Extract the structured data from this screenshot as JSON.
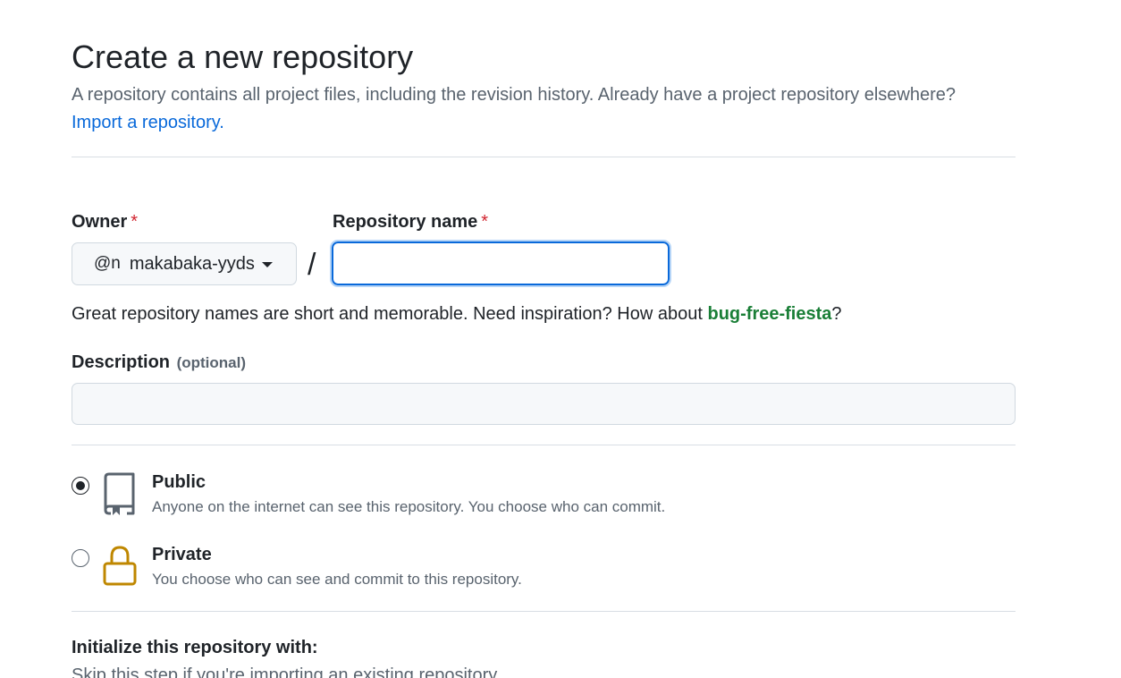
{
  "header": {
    "title": "Create a new repository",
    "subtitle": "A repository contains all project files, including the revision history. Already have a project repository elsewhere?",
    "import_link": "Import a repository."
  },
  "owner": {
    "label": "Owner",
    "required_mark": "*",
    "avatar_text": "@n",
    "selected": "makabaka-yyds"
  },
  "separator": "/",
  "repo_name": {
    "label": "Repository name",
    "required_mark": "*",
    "value": ""
  },
  "name_hint": {
    "text": "Great repository names are short and memorable. Need inspiration? How about ",
    "suggestion": "bug-free-fiesta",
    "suffix": "?"
  },
  "description": {
    "label": "Description",
    "optional": "(optional)",
    "value": ""
  },
  "visibility": {
    "options": [
      {
        "title": "Public",
        "description": "Anyone on the internet can see this repository. You choose who can commit.",
        "icon": "repo-icon",
        "checked": true
      },
      {
        "title": "Private",
        "description": "You choose who can see and commit to this repository.",
        "icon": "lock-icon",
        "checked": false
      }
    ]
  },
  "initialize": {
    "heading": "Initialize this repository with:",
    "subtext": "Skip this step if you're importing an existing repository."
  },
  "colors": {
    "link": "#0969da",
    "suggestion": "#1a7f37",
    "required": "#d1242f",
    "lock_icon": "#bf8700",
    "repo_icon": "#59636e"
  }
}
